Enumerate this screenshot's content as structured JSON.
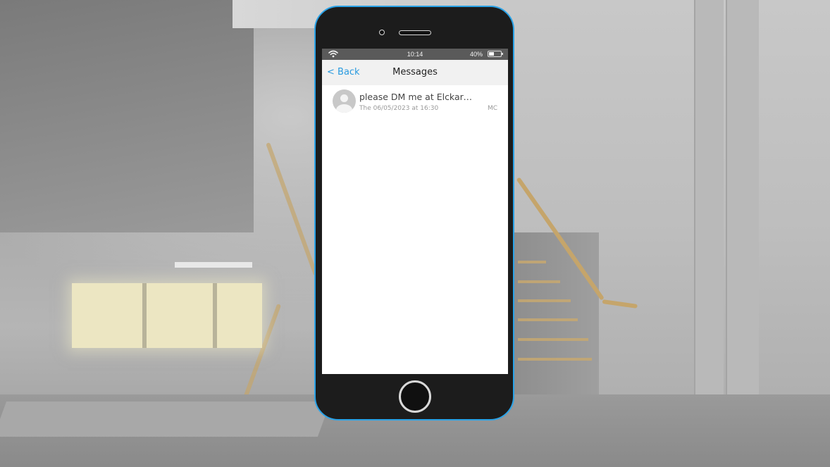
{
  "status_bar": {
    "time": "10:14",
    "battery_percent_label": "40%",
    "battery_level": 0.4
  },
  "nav": {
    "back_label": "< Back",
    "title": "Messages"
  },
  "messages": [
    {
      "preview": "please DM me at Elckarow...",
      "date": "The 06/05/2023 at 16:30",
      "sender": "MC"
    }
  ],
  "colors": {
    "phone_border": "#2aa3e8",
    "back_link": "#2a9be0",
    "status_bar": "#5a5a5a",
    "nav_bar": "#f1f1f1"
  }
}
